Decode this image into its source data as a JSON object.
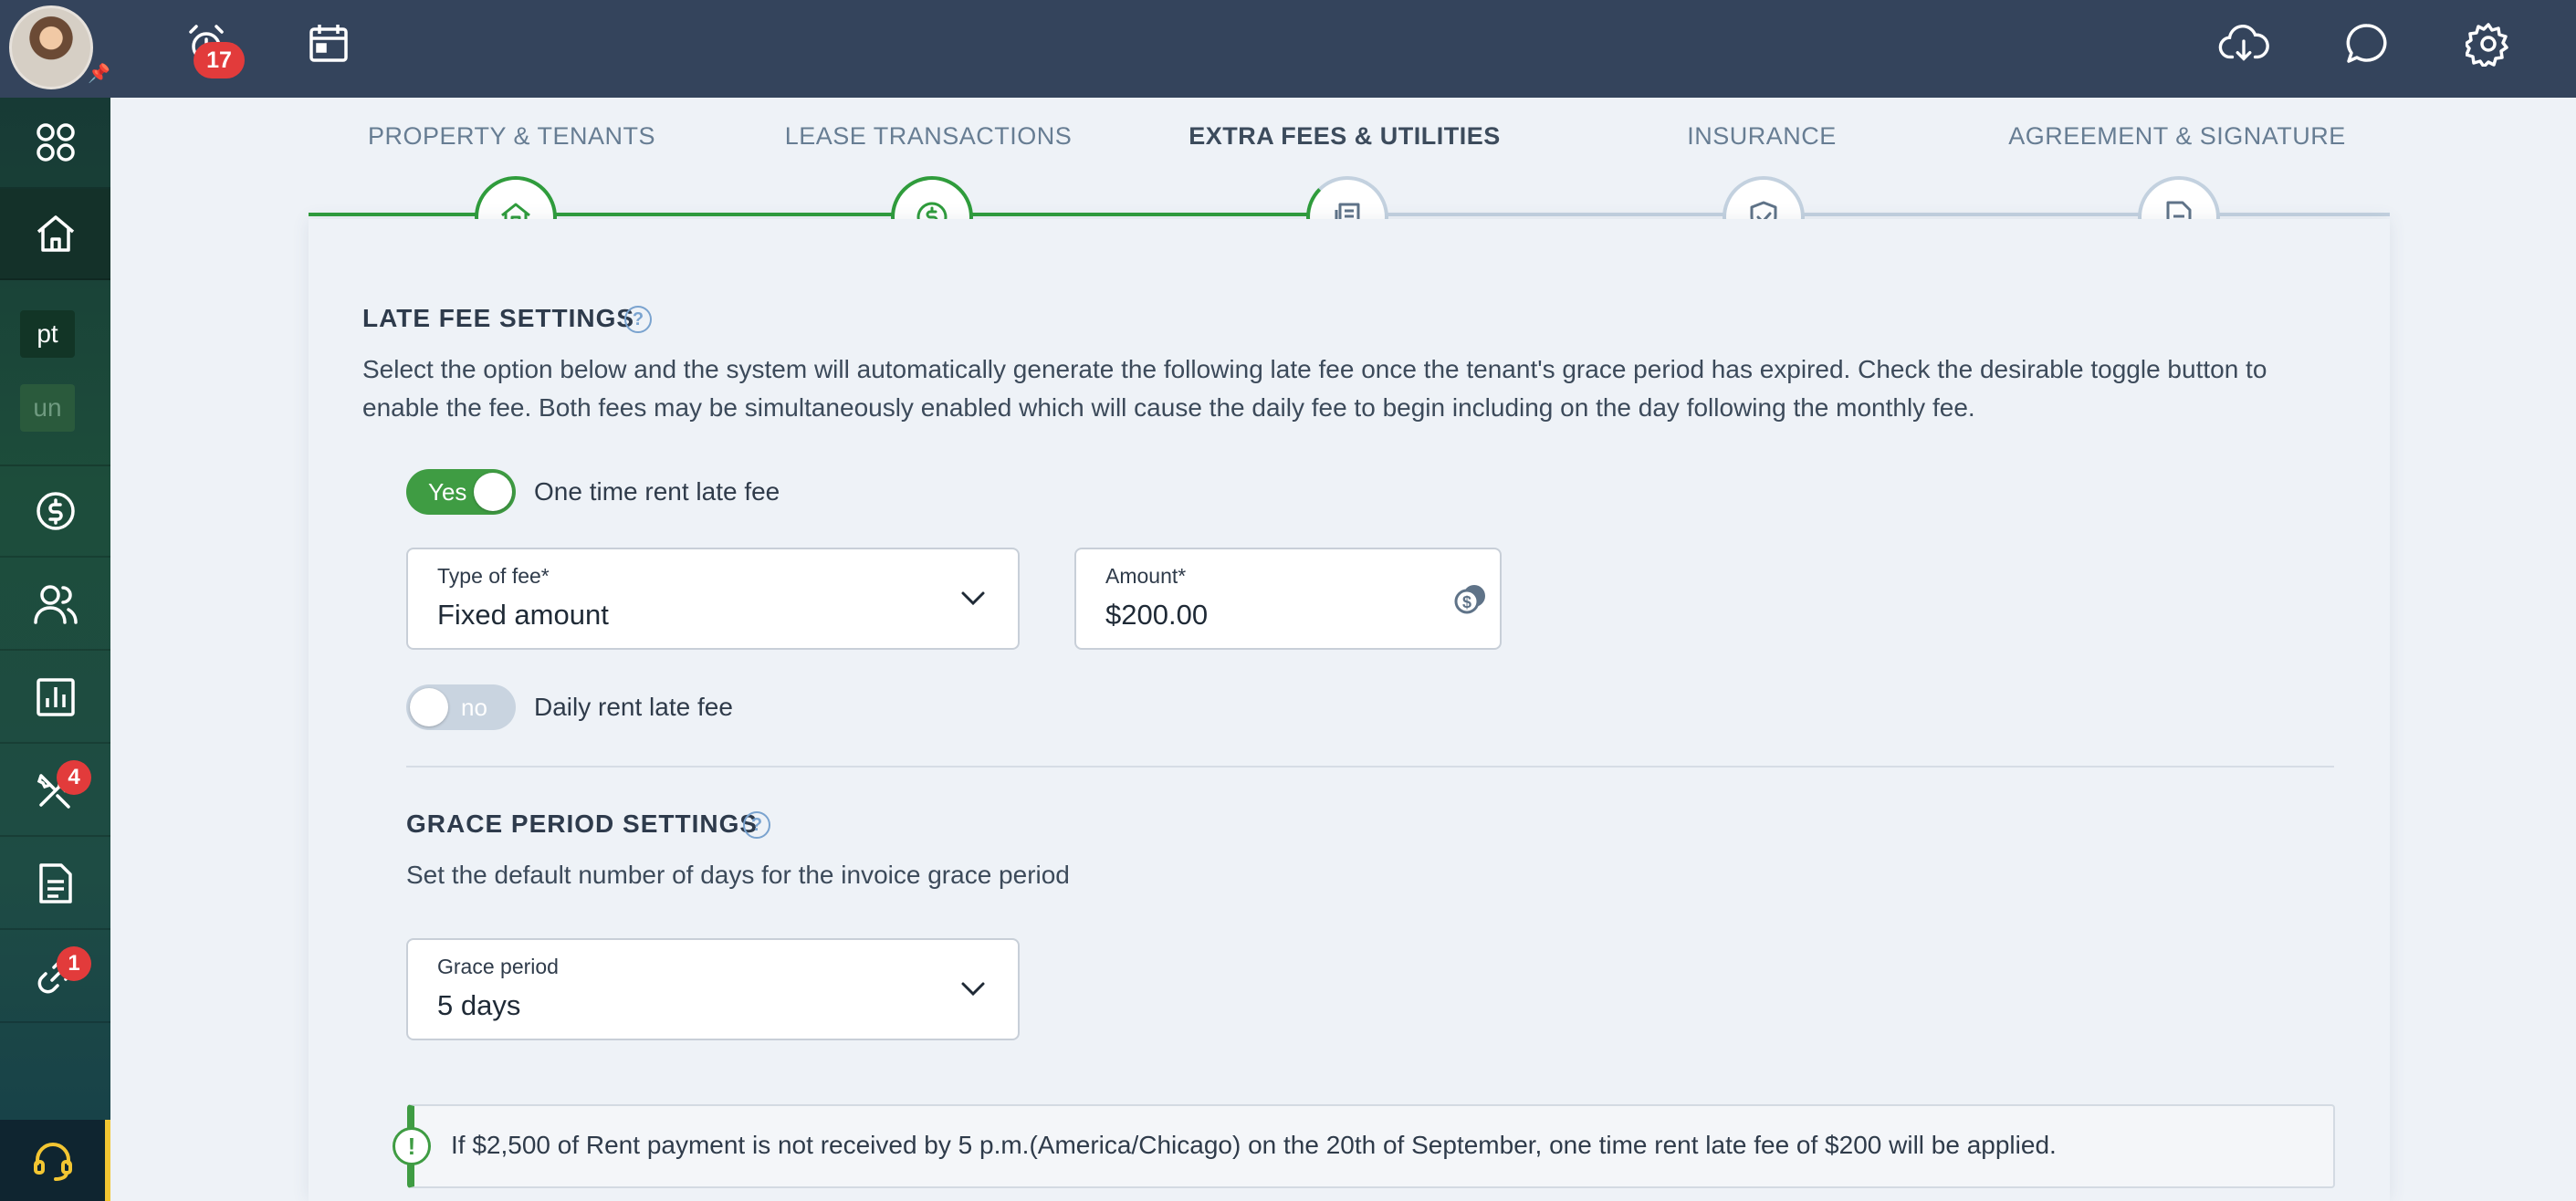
{
  "topbar": {
    "notification_count": "17"
  },
  "sidebar": {
    "tag1": "pt",
    "tag2": "un",
    "tools_badge": "4",
    "links_badge": "1"
  },
  "steps": [
    {
      "label": "PROPERTY & TENANTS",
      "state": "done",
      "icon": "house-icon"
    },
    {
      "label": "LEASE TRANSACTIONS",
      "state": "done",
      "icon": "dollar-icon"
    },
    {
      "label": "EXTRA FEES & UTILITIES",
      "state": "current",
      "icon": "receipt-icon"
    },
    {
      "label": "INSURANCE",
      "state": "todo",
      "icon": "shield-icon"
    },
    {
      "label": "AGREEMENT & SIGNATURE",
      "state": "todo",
      "icon": "document-icon"
    }
  ],
  "late_fee": {
    "title": "LATE FEE SETTINGS",
    "description_line1": "Select the option below and the system will automatically generate the following late fee once the tenant's grace period has expired. Check the desirable toggle button to",
    "description_line2": "enable the fee. Both fees may be simultaneously enabled which will cause the daily fee to begin including on the day following the monthly fee.",
    "one_time_toggle": {
      "state_text": "Yes",
      "label": "One time rent late fee"
    },
    "type_of_fee": {
      "label": "Type of fee*",
      "value": "Fixed amount"
    },
    "amount": {
      "label": "Amount*",
      "value": "$200.00"
    },
    "daily_toggle": {
      "state_text": "no",
      "label": "Daily rent late fee"
    }
  },
  "grace_period": {
    "title": "GRACE PERIOD SETTINGS",
    "description": "Set the default number of days for the invoice grace period",
    "field": {
      "label": "Grace period",
      "value": "5 days"
    }
  },
  "info": {
    "text": "If $2,500 of Rent payment is not received by 5 p.m.(America/Chicago) on the 20th of September, one time rent late fee of $200 will be applied."
  },
  "colors": {
    "accent_green": "#3f9c43",
    "topbar": "#34445c",
    "badge_red": "#e23b3b"
  }
}
